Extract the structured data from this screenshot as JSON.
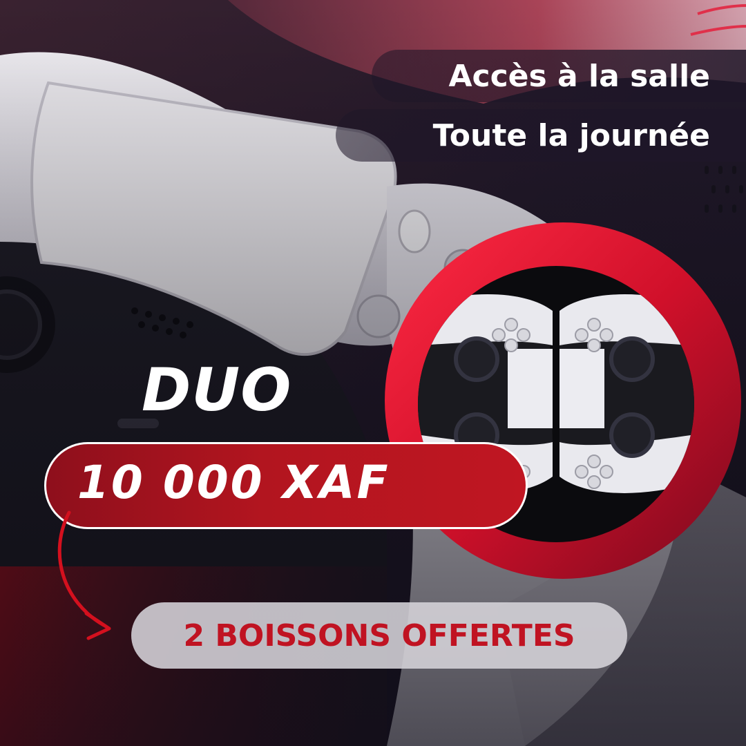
{
  "tagline": {
    "line1": "Accès à la salle",
    "line2": "Toute la journée"
  },
  "offer_name": "DUO",
  "price": "10 000 XAF",
  "bonus": "2 BOISSONS OFFERTES",
  "colors": {
    "accent_red": "#c01622",
    "dark_bg": "#1a1220",
    "controller_white": "#ecebf0",
    "controller_black": "#1c1b22"
  },
  "icons": [
    "controller-photo",
    "duo-controllers-photo",
    "curved-arrow-icon"
  ]
}
